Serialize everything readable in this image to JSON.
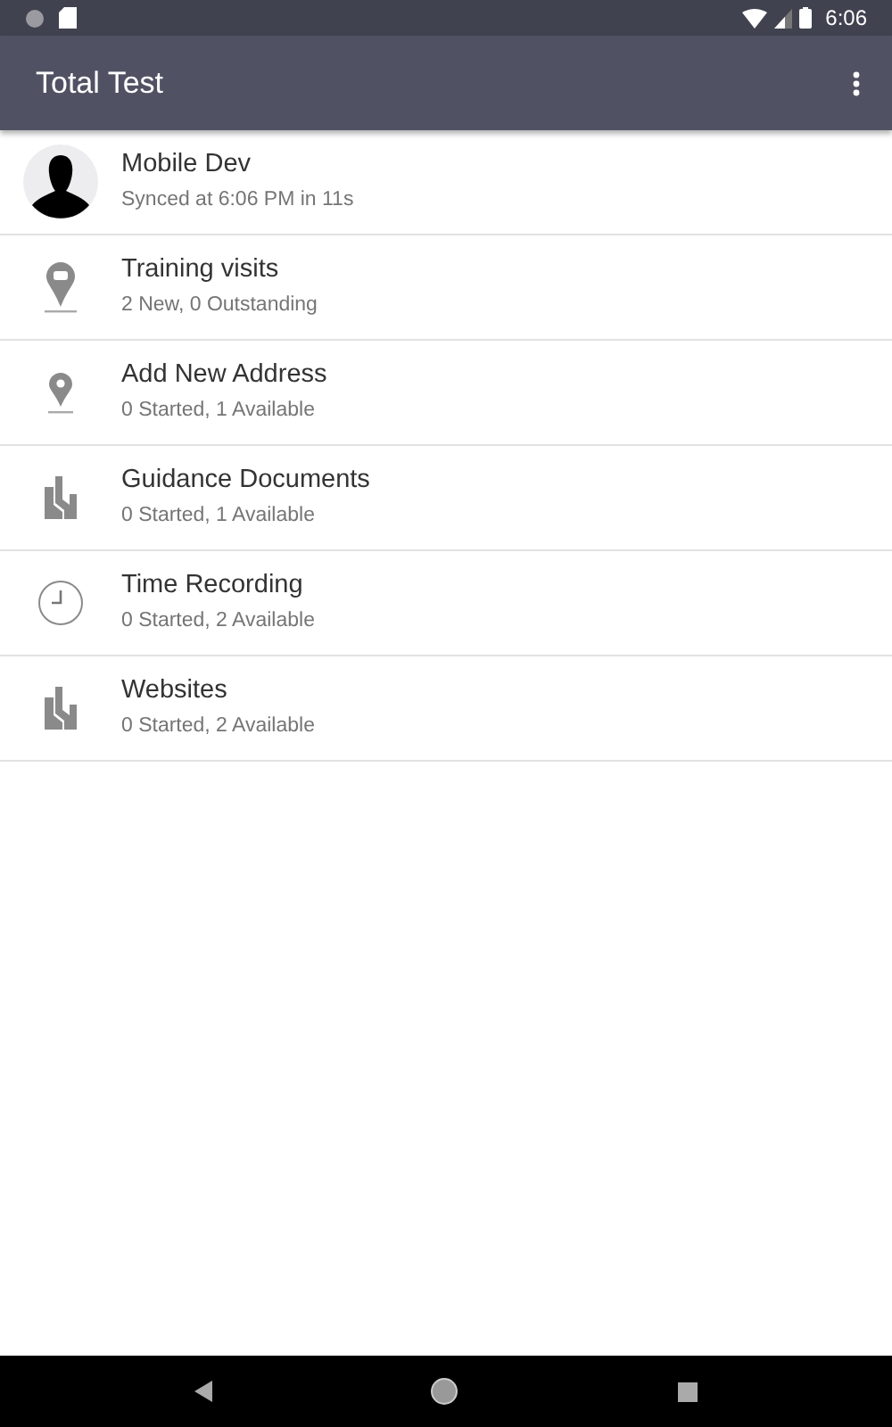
{
  "status_bar": {
    "time": "6:06"
  },
  "app_bar": {
    "title": "Total Test"
  },
  "items": [
    {
      "kind": "avatar",
      "title": "Mobile Dev",
      "subtitle": "Synced at 6:06 PM in 11s"
    },
    {
      "kind": "pin",
      "title": "Training visits",
      "subtitle": "2 New, 0 Outstanding"
    },
    {
      "kind": "pin-small",
      "title": "Add New Address",
      "subtitle": "0 Started, 1 Available"
    },
    {
      "kind": "documents",
      "title": "Guidance Documents",
      "subtitle": "0 Started, 1 Available"
    },
    {
      "kind": "clock",
      "title": "Time Recording",
      "subtitle": "0 Started, 2 Available"
    },
    {
      "kind": "documents",
      "title": "Websites",
      "subtitle": "0 Started, 2 Available"
    }
  ]
}
